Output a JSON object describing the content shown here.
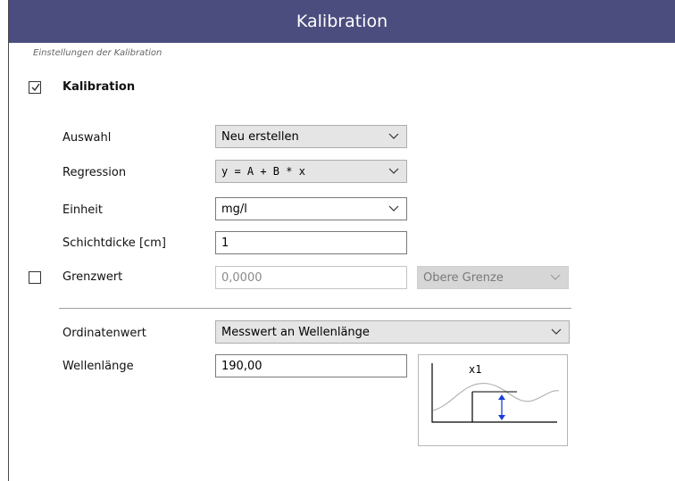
{
  "title": "Kalibration",
  "section_label": "Einstellungen der Kalibration",
  "calibration": {
    "label": "Kalibration",
    "checked": true
  },
  "auswahl": {
    "label": "Auswahl",
    "value": "Neu erstellen"
  },
  "regression": {
    "label": "Regression",
    "value": "y = A + B * x"
  },
  "einheit": {
    "label": "Einheit",
    "value": "mg/l"
  },
  "schichtdicke": {
    "label": "Schichtdicke [cm]",
    "value": "1"
  },
  "grenzwert": {
    "label": "Grenzwert",
    "checked": false,
    "value": "0,0000",
    "bound": "Obere Grenze"
  },
  "ordinatenwert": {
    "label": "Ordinatenwert",
    "value": "Messwert an Wellenlänge"
  },
  "wellenlaenge": {
    "label": "Wellenlänge",
    "value": "190,00"
  },
  "diagram": {
    "marker_label": "x1"
  },
  "colors": {
    "title_bar": "#4b4d7f",
    "arrow": "#1a3fd6"
  }
}
